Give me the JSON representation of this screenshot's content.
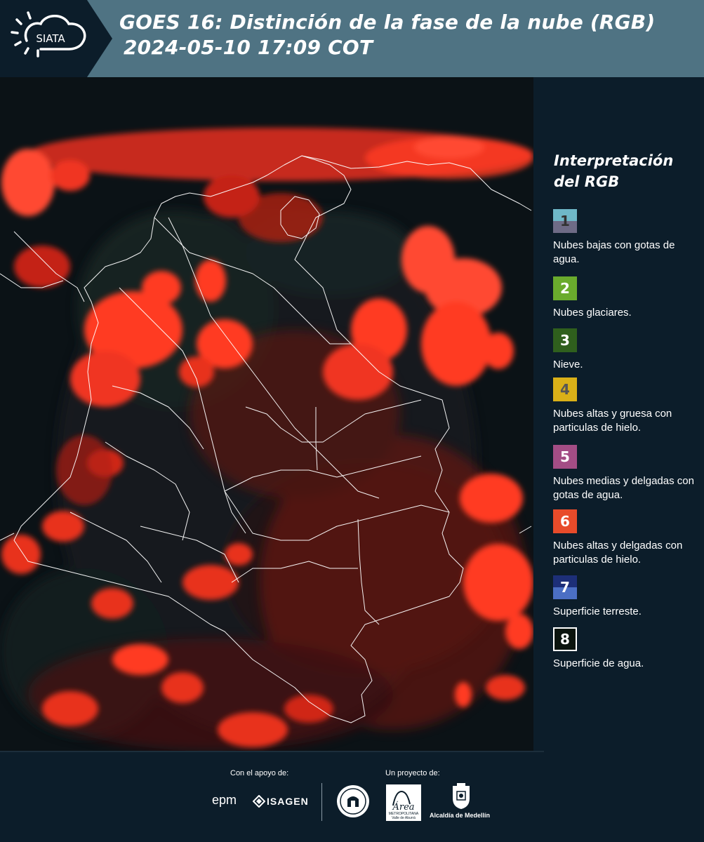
{
  "header": {
    "logo_text": "SIATA",
    "title_line1": "GOES 16: Distinción de la fase de la nube (RGB)",
    "title_line2": "2024-05-10 17:09 COT"
  },
  "legend": {
    "title_line1": "Interpretación",
    "title_line2": "del RGB",
    "items": [
      {
        "number": "1",
        "label": "Nubes bajas con gotas de agua.",
        "colors": [
          "#6fb8c8",
          "#6e6b86"
        ],
        "number_color": "#333333"
      },
      {
        "number": "2",
        "label": "Nubes glaciares.",
        "colors": [
          "#6aab2d"
        ],
        "number_color": "#ffffff"
      },
      {
        "number": "3",
        "label": "Nieve.",
        "colors": [
          "#2f5f1d"
        ],
        "number_color": "#ffffff"
      },
      {
        "number": "4",
        "label": "Nubes altas y gruesa con particulas de hielo.",
        "colors": [
          "#d9b018"
        ],
        "number_color": "#555555"
      },
      {
        "number": "5",
        "label": "Nubes medias y delgadas con gotas de agua.",
        "colors": [
          "#a34d85"
        ],
        "number_color": "#ffffff"
      },
      {
        "number": "6",
        "label": "Nubes altas y delgadas con particulas de hielo.",
        "colors": [
          "#e84b2a"
        ],
        "number_color": "#ffffff"
      },
      {
        "number": "7",
        "label": "Superficie terreste.",
        "colors": [
          "#1d2f78",
          "#4b6fc4"
        ],
        "number_color": "#ffffff"
      },
      {
        "number": "8",
        "label": "Superficie de agua.",
        "colors": [
          "#0b140e"
        ],
        "number_color": "#ffffff",
        "border": "#ffffff"
      }
    ]
  },
  "footer": {
    "support_label": "Con el apoyo de:",
    "project_label": "Un proyecto de:",
    "epm": "epm",
    "isagen": "ISAGEN",
    "metropolitana": "METROPOLITANA",
    "valle": "Valle de Aburrá",
    "alcaldia": "Alcaldía de Medellín"
  },
  "colors": {
    "header_bg": "#4f7383",
    "page_bg": "#0c1d2a",
    "cloud_red": "#ff3b22",
    "border_white": "#ffffff"
  }
}
